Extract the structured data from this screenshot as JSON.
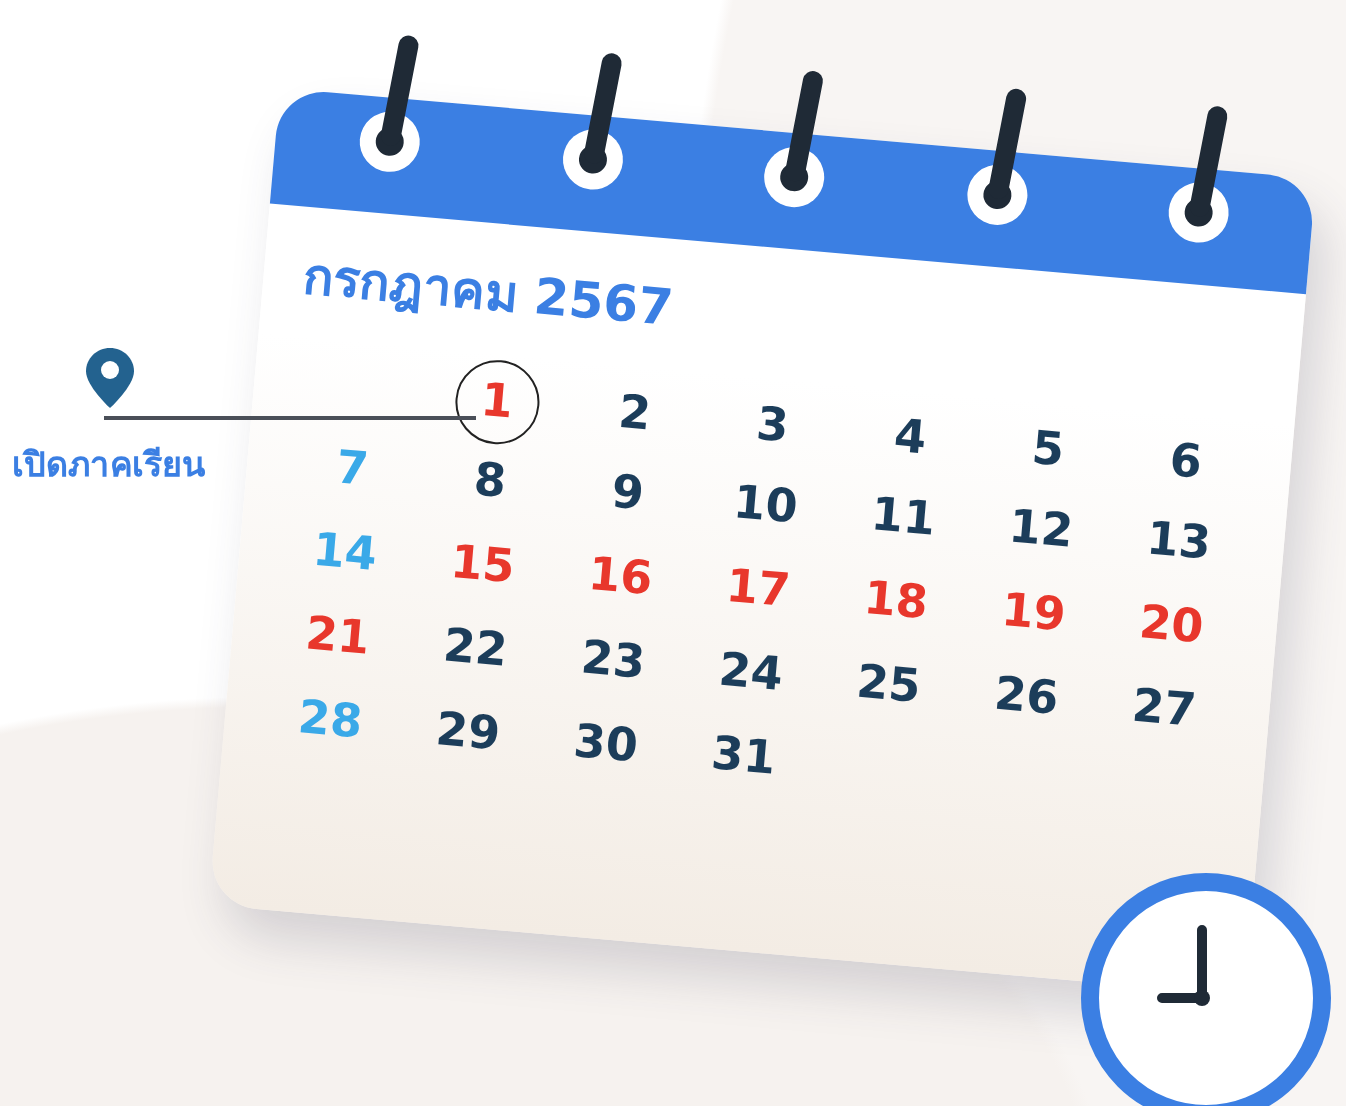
{
  "marker": {
    "label": "เปิดภาคเรียน"
  },
  "calendar": {
    "title": "กรกฎาคม 2567",
    "weeks": [
      [
        {
          "day": "1",
          "color": "#e8372c",
          "circled": true
        },
        {
          "day": "2",
          "color": "#1c3d5a",
          "circled": false
        },
        {
          "day": "3",
          "color": "#1c3d5a",
          "circled": false
        },
        {
          "day": "4",
          "color": "#1c3d5a",
          "circled": false
        },
        {
          "day": "5",
          "color": "#1c3d5a",
          "circled": false
        },
        {
          "day": "6",
          "color": "#1c3d5a",
          "circled": false
        }
      ],
      [
        {
          "day": "7",
          "color": "#3aa9e8",
          "circled": false
        },
        {
          "day": "8",
          "color": "#1c3d5a",
          "circled": false
        },
        {
          "day": "9",
          "color": "#1c3d5a",
          "circled": false
        },
        {
          "day": "10",
          "color": "#1c3d5a",
          "circled": false
        },
        {
          "day": "11",
          "color": "#1c3d5a",
          "circled": false
        },
        {
          "day": "12",
          "color": "#1c3d5a",
          "circled": false
        },
        {
          "day": "13",
          "color": "#1c3d5a",
          "circled": false
        }
      ],
      [
        {
          "day": "14",
          "color": "#3aa9e8",
          "circled": false
        },
        {
          "day": "15",
          "color": "#e8372c",
          "circled": false
        },
        {
          "day": "16",
          "color": "#e8372c",
          "circled": false
        },
        {
          "day": "17",
          "color": "#e8372c",
          "circled": false
        },
        {
          "day": "18",
          "color": "#e8372c",
          "circled": false
        },
        {
          "day": "19",
          "color": "#e8372c",
          "circled": false
        },
        {
          "day": "20",
          "color": "#e8372c",
          "circled": false
        }
      ],
      [
        {
          "day": "21",
          "color": "#e8372c",
          "circled": false
        },
        {
          "day": "22",
          "color": "#1c3d5a",
          "circled": false
        },
        {
          "day": "23",
          "color": "#1c3d5a",
          "circled": false
        },
        {
          "day": "24",
          "color": "#1c3d5a",
          "circled": false
        },
        {
          "day": "25",
          "color": "#1c3d5a",
          "circled": false
        },
        {
          "day": "26",
          "color": "#1c3d5a",
          "circled": false
        },
        {
          "day": "27",
          "color": "#1c3d5a",
          "circled": false
        }
      ],
      [
        {
          "day": "28",
          "color": "#3aa9e8",
          "circled": false
        },
        {
          "day": "29",
          "color": "#1c3d5a",
          "circled": false
        },
        {
          "day": "30",
          "color": "#1c3d5a",
          "circled": false
        },
        {
          "day": "31",
          "color": "#1c3d5a",
          "circled": false
        }
      ]
    ]
  }
}
